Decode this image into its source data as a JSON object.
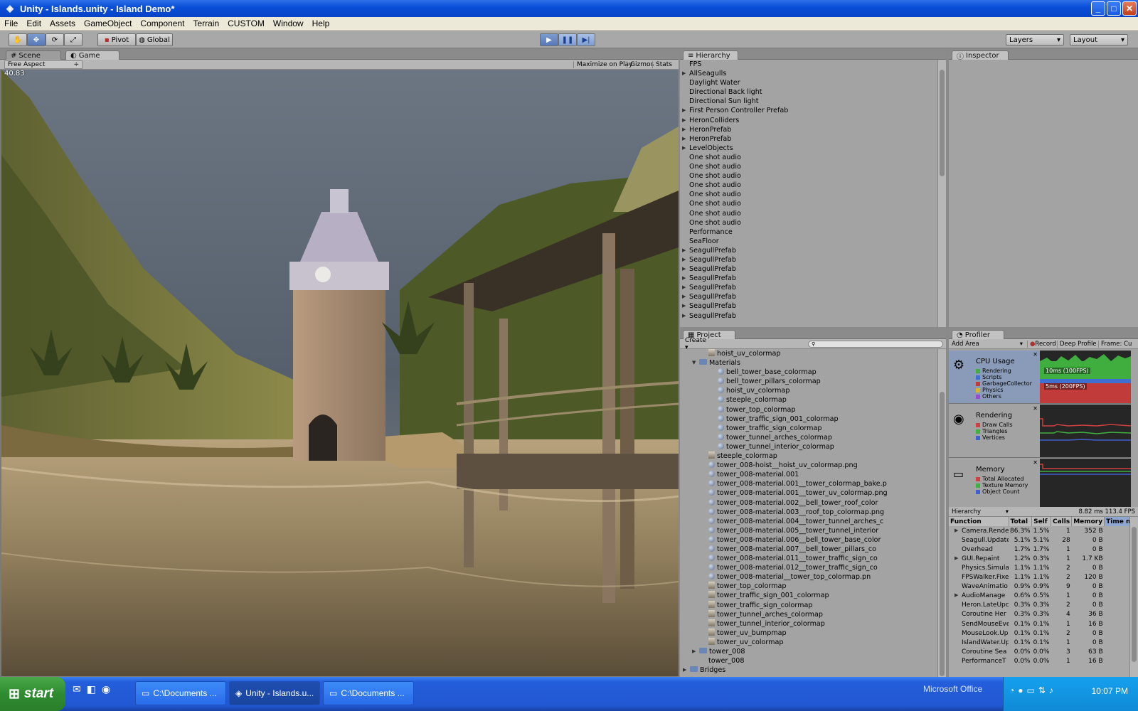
{
  "window": {
    "title": "Unity - Islands.unity - Island Demo*"
  },
  "menu": [
    "File",
    "Edit",
    "Assets",
    "GameObject",
    "Component",
    "Terrain",
    "CUSTOM",
    "Window",
    "Help"
  ],
  "toolbar": {
    "pivot": "Pivot",
    "global": "Global",
    "layers": "Layers",
    "layout": "Layout"
  },
  "scene_panel": {
    "tab_scene": "Scene",
    "tab_game": "Game",
    "aspect": "Free Aspect",
    "maximize": "Maximize on Play",
    "gizmos": "Gizmos",
    "stats": "Stats",
    "fps": "40.83"
  },
  "hierarchy": {
    "tab": "Hierarchy",
    "items": [
      {
        "label": "FPS",
        "arrow": false
      },
      {
        "label": "AllSeagulls",
        "arrow": true
      },
      {
        "label": "Daylight Water",
        "arrow": false
      },
      {
        "label": "Directional Back light",
        "arrow": false
      },
      {
        "label": "Directional Sun light",
        "arrow": false
      },
      {
        "label": "First Person Controller Prefab",
        "arrow": true
      },
      {
        "label": "HeronColliders",
        "arrow": true
      },
      {
        "label": "HeronPrefab",
        "arrow": true
      },
      {
        "label": "HeronPrefab",
        "arrow": true
      },
      {
        "label": "LevelObjects",
        "arrow": true
      },
      {
        "label": "One shot audio",
        "arrow": false
      },
      {
        "label": "One shot audio",
        "arrow": false
      },
      {
        "label": "One shot audio",
        "arrow": false
      },
      {
        "label": "One shot audio",
        "arrow": false
      },
      {
        "label": "One shot audio",
        "arrow": false
      },
      {
        "label": "One shot audio",
        "arrow": false
      },
      {
        "label": "One shot audio",
        "arrow": false
      },
      {
        "label": "One shot audio",
        "arrow": false
      },
      {
        "label": "Performance",
        "arrow": false
      },
      {
        "label": "SeaFloor",
        "arrow": false
      },
      {
        "label": "SeagullPrefab",
        "arrow": true
      },
      {
        "label": "SeagullPrefab",
        "arrow": true
      },
      {
        "label": "SeagullPrefab",
        "arrow": true
      },
      {
        "label": "SeagullPrefab",
        "arrow": true
      },
      {
        "label": "SeagullPrefab",
        "arrow": true
      },
      {
        "label": "SeagullPrefab",
        "arrow": true
      },
      {
        "label": "SeagullPrefab",
        "arrow": true
      },
      {
        "label": "SeagullPrefab",
        "arrow": true
      }
    ]
  },
  "inspector": {
    "tab": "Inspector"
  },
  "project": {
    "tab": "Project",
    "create": "Create",
    "items": [
      {
        "label": "hoist_uv_colormap",
        "icon": "tex",
        "indent": 2
      },
      {
        "label": "Materials",
        "icon": "folder",
        "indent": 1,
        "arrow": "open"
      },
      {
        "label": "bell_tower_base_colormap",
        "icon": "mat",
        "indent": 3
      },
      {
        "label": "bell_tower_pillars_colormap",
        "icon": "mat",
        "indent": 3
      },
      {
        "label": "hoist_uv_colormap",
        "icon": "mat",
        "indent": 3
      },
      {
        "label": "steeple_colormap",
        "icon": "mat",
        "indent": 3
      },
      {
        "label": "tower_top_colormap",
        "icon": "mat",
        "indent": 3
      },
      {
        "label": "tower_traffic_sign_001_colormap",
        "icon": "mat",
        "indent": 3
      },
      {
        "label": "tower_traffic_sign_colormap",
        "icon": "mat",
        "indent": 3
      },
      {
        "label": "tower_tunnel_arches_colormap",
        "icon": "mat",
        "indent": 3
      },
      {
        "label": "tower_tunnel_interior_colormap",
        "icon": "mat",
        "indent": 3
      },
      {
        "label": "steeple_colormap",
        "icon": "tex",
        "indent": 2
      },
      {
        "label": "tower_008-hoist__hoist_uv_colormap.png",
        "icon": "mat",
        "indent": 2
      },
      {
        "label": "tower_008-material.001",
        "icon": "mat",
        "indent": 2
      },
      {
        "label": "tower_008-material.001__tower_colormap_bake.p",
        "icon": "mat",
        "indent": 2
      },
      {
        "label": "tower_008-material.001__tower_uv_colormap.png",
        "icon": "mat",
        "indent": 2
      },
      {
        "label": "tower_008-material.002__bell_tower_roof_color",
        "icon": "mat",
        "indent": 2
      },
      {
        "label": "tower_008-material.003__roof_top_colormap.png",
        "icon": "mat",
        "indent": 2
      },
      {
        "label": "tower_008-material.004__tower_tunnel_arches_c",
        "icon": "mat",
        "indent": 2
      },
      {
        "label": "tower_008-material.005__tower_tunnel_interior",
        "icon": "mat",
        "indent": 2
      },
      {
        "label": "tower_008-material.006__bell_tower_base_color",
        "icon": "mat",
        "indent": 2
      },
      {
        "label": "tower_008-material.007__bell_tower_pillars_co",
        "icon": "mat",
        "indent": 2
      },
      {
        "label": "tower_008-material.011__tower_traffic_sign_co",
        "icon": "mat",
        "indent": 2
      },
      {
        "label": "tower_008-material.012__tower_traffic_sign_co",
        "icon": "mat",
        "indent": 2
      },
      {
        "label": "tower_008-material__tower_top_colormap.pn",
        "icon": "mat",
        "indent": 2
      },
      {
        "label": "tower_top_colormap",
        "icon": "tex",
        "indent": 2
      },
      {
        "label": "tower_traffic_sign_001_colormap",
        "icon": "tex",
        "indent": 2
      },
      {
        "label": "tower_traffic_sign_colormap",
        "icon": "tex",
        "indent": 2
      },
      {
        "label": "tower_tunnel_arches_colormap",
        "icon": "tex",
        "indent": 2
      },
      {
        "label": "tower_tunnel_interior_colormap",
        "icon": "tex",
        "indent": 2
      },
      {
        "label": "tower_uv_bumpmap",
        "icon": "tex",
        "indent": 2
      },
      {
        "label": "tower_uv_colormap",
        "icon": "tex",
        "indent": 2
      },
      {
        "label": "tower_008",
        "icon": "prefab",
        "indent": 1,
        "arrow": "closed"
      },
      {
        "label": "tower_008",
        "icon": "none",
        "indent": 2
      },
      {
        "label": "Bridges",
        "icon": "folder",
        "indent": 0,
        "arrow": "closed"
      }
    ]
  },
  "profiler": {
    "tab": "Profiler",
    "add_area": "Add Area",
    "record": "Record",
    "deep": "Deep Profile",
    "frame": "Frame: Cu",
    "areas": [
      {
        "title": "CPU Usage",
        "legend": [
          {
            "name": "Rendering",
            "color": "#3fae3f"
          },
          {
            "name": "Scripts",
            "color": "#3f6fd0"
          },
          {
            "name": "GarbageCollector",
            "color": "#c23b3b"
          },
          {
            "name": "Physics",
            "color": "#d8b42a"
          },
          {
            "name": "Others",
            "color": "#9b4bd0"
          }
        ]
      },
      {
        "title": "Rendering",
        "legend": [
          {
            "name": "Draw Calls",
            "color": "#d04040"
          },
          {
            "name": "Triangles",
            "color": "#40b040"
          },
          {
            "name": "Vertices",
            "color": "#4060d0"
          }
        ]
      },
      {
        "title": "Memory",
        "legend": [
          {
            "name": "Total Allocated",
            "color": "#d04040"
          },
          {
            "name": "Texture Memory",
            "color": "#40b040"
          },
          {
            "name": "Object Count",
            "color": "#4060d0"
          }
        ]
      }
    ],
    "graph_labels": {
      "ms10": "10ms (100FPS)",
      "ms5": "5ms (200FPS)"
    },
    "view": "Hierarchy",
    "timing": "8.82 ms  113.4 FPS",
    "columns": [
      "Function",
      "Total",
      "Self",
      "Calls",
      "Memory",
      "Time m"
    ],
    "rows": [
      [
        "Camera.Rende",
        "86.3%",
        "1.5%",
        "1",
        "352 B",
        true
      ],
      [
        "Seagull.Update",
        "5.1%",
        "5.1%",
        "28",
        "0 B",
        false
      ],
      [
        "Overhead",
        "1.7%",
        "1.7%",
        "1",
        "0 B",
        false
      ],
      [
        "GUI.Repaint",
        "1.2%",
        "0.3%",
        "1",
        "1.7 KB",
        true
      ],
      [
        "Physics.Simula",
        "1.1%",
        "1.1%",
        "2",
        "0 B",
        false
      ],
      [
        "FPSWalker.Fixe",
        "1.1%",
        "1.1%",
        "2",
        "120 B",
        false
      ],
      [
        "WaveAnimatio",
        "0.9%",
        "0.9%",
        "9",
        "0 B",
        false
      ],
      [
        "AudioManage",
        "0.6%",
        "0.5%",
        "1",
        "0 B",
        true
      ],
      [
        "Heron.LateUpc",
        "0.3%",
        "0.3%",
        "2",
        "0 B",
        false
      ],
      [
        "Coroutine Her",
        "0.3%",
        "0.3%",
        "4",
        "36 B",
        false
      ],
      [
        "SendMouseEve",
        "0.1%",
        "0.1%",
        "1",
        "16 B",
        false
      ],
      [
        "MouseLook.Up",
        "0.1%",
        "0.1%",
        "2",
        "0 B",
        false
      ],
      [
        "IslandWater.Up",
        "0.1%",
        "0.1%",
        "1",
        "0 B",
        false
      ],
      [
        "Coroutine Sea",
        "0.0%",
        "0.0%",
        "3",
        "63 B",
        false
      ],
      [
        "PerformanceT",
        "0.0%",
        "0.0%",
        "1",
        "16 B",
        false
      ]
    ]
  },
  "taskbar": {
    "start": "start",
    "tasks": [
      "C:\\Documents ...",
      "Unity - Islands.u...",
      "C:\\Documents ..."
    ],
    "office": "Microsoft Office",
    "clock": "10:07 PM"
  }
}
